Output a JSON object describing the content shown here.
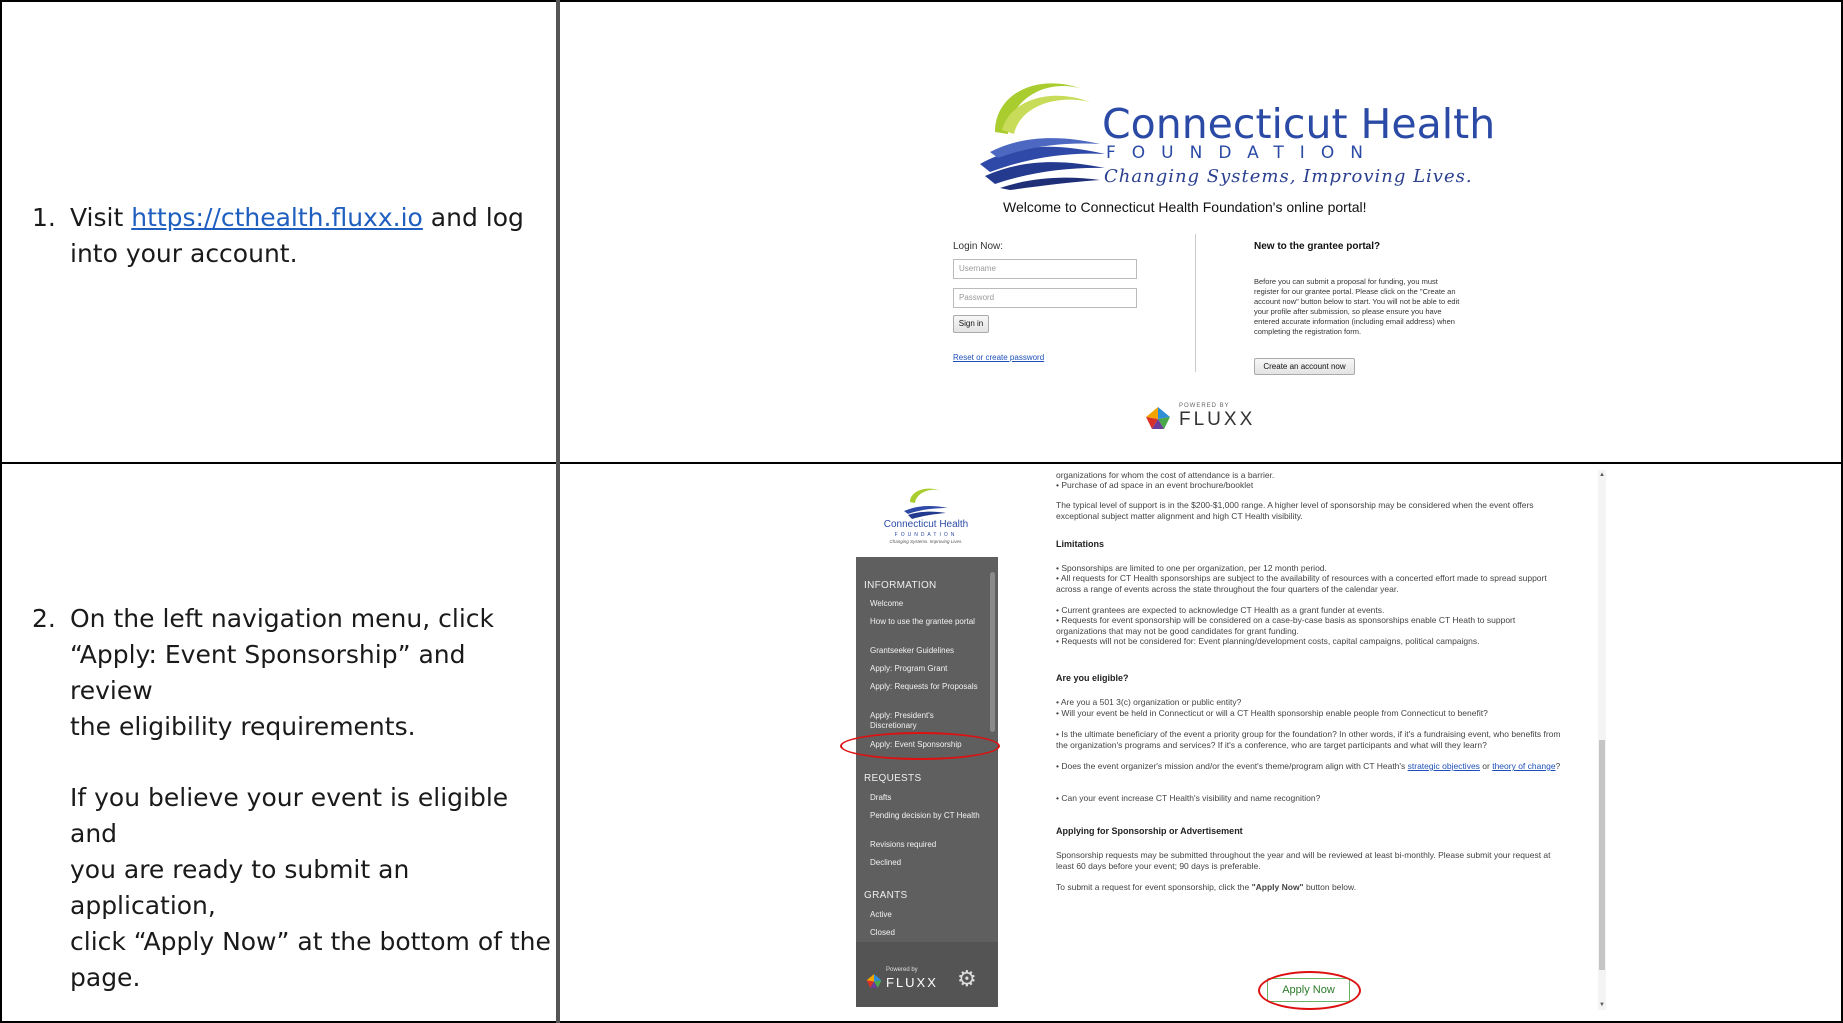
{
  "step1": {
    "number": "1.",
    "text_before": "Visit ",
    "link": "https://cthealth.fluxx.io",
    "text_after": " and log",
    "line2": "into your account."
  },
  "step2": {
    "number": "2.",
    "para1": [
      "On the left navigation menu, click",
      "“Apply: Event Sponsorship” and review",
      "the eligibility requirements."
    ],
    "para2": [
      "If you believe your event is eligible and",
      "you are ready to submit an application,",
      "click “Apply Now” at the bottom of the",
      "page."
    ]
  },
  "login_screen": {
    "brand_name": "Connecticut Health",
    "brand_sub": "FOUNDATION",
    "brand_tagline": "Changing Systems, Improving Lives.",
    "welcome": "Welcome to Connecticut Health Foundation's online portal!",
    "login_label": "Login Now:",
    "username_placeholder": "Username",
    "password_placeholder": "Password",
    "signin_label": "Sign in",
    "reset_link": "Reset or create password",
    "new_title": "New to the grantee portal?",
    "new_body": "Before you can submit a proposal for funding, you must register for our grantee portal. Please click on the \"Create an account now\" button below to start. You will not be able to edit your profile after submission, so please ensure you have entered accurate information (including email address) when completing the registration form.",
    "create_account_label": "Create an account now",
    "powered_by": "POWERED BY",
    "fluxx": "FLUXX"
  },
  "portal_screen": {
    "logo_name": "Connecticut Health",
    "logo_sub": "FOUNDATION",
    "logo_tag": "Changing Systems. Improving Lives.",
    "sidebar": {
      "info_head": "INFORMATION",
      "info_items": [
        "Welcome",
        "How to use the grantee portal",
        "Grantseeker Guidelines",
        "Apply: Program Grant",
        "Apply: Requests for Proposals",
        "Apply: President's Discretionary",
        "Apply: Event Sponsorship"
      ],
      "requests_head": "REQUESTS",
      "requests_items": [
        "Drafts",
        "Pending decision by CT Health",
        "Revisions required",
        "Declined"
      ],
      "grants_head": "GRANTS",
      "grants_items": [
        "Active",
        "Closed"
      ],
      "powered_by": "Powered by",
      "fluxx": "FLUXX"
    },
    "content": {
      "top_line1": "organizations for whom the cost of attendance is a barrier.",
      "top_line2": "• Purchase of ad space in an event brochure/booklet",
      "typical": "The typical level of support is in the $200-$1,000 range. A higher level of sponsorship may be considered when the event offers exceptional subject matter alignment and high CT Health visibility.",
      "limitations_head": "Limitations",
      "limitations": [
        "• Sponsorships are limited to one per organization, per 12 month period.",
        "• All requests for CT Health sponsorships are subject to the availability of resources with a concerted effort made to spread support across a range of events across the state throughout the four quarters of the calendar year.",
        "• Current grantees are expected to acknowledge CT Health as a grant funder at events.",
        "• Requests for event sponsorship will be considered on a case-by-case basis as sponsorships enable CT Heath to support organizations that may not be good candidates for grant funding.",
        "• Requests will not be considered for: Event planning/development costs, capital campaigns, political campaigns."
      ],
      "eligible_head": "Are you eligible?",
      "eligible": [
        "• Are you a 501 3(c) organization or public entity?",
        "• Will your event be held in Connecticut or will a CT Health sponsorship enable people from Connecticut to benefit?",
        "• Is the ultimate beneficiary of the event a priority group for the foundation? In other words, if it's a fundraising event, who benefits from the organization's programs and services? If it's a conference, who are target participants and what will they learn?"
      ],
      "mission_before": "• Does the event organizer's mission and/or the event's theme/program align with CT Heath's ",
      "mission_link1": "strategic objectives",
      "mission_or": " or ",
      "mission_link2": "theory of change",
      "mission_after": "?",
      "visibility": "• Can your event increase CT Health's visibility and name recognition?",
      "applying_head": "Applying for Sponsorship or Advertisement",
      "applying_body": "Sponsorship requests may be submitted throughout the year and will be reviewed at least bi-monthly.  Please submit your request at least 60 days before your event; 90 days is preferable.",
      "submit_before": "To submit a request for event sponsorship, click the ",
      "submit_bold": "\"Apply Now\"",
      "submit_after": " button below.",
      "apply_button": "Apply Now"
    }
  },
  "colors": {
    "brand_blue": "#2b4aa6",
    "highlight_red": "#dd1111",
    "sidebar_gray": "#5f5f5f",
    "apply_green": "#2a7a2a"
  }
}
